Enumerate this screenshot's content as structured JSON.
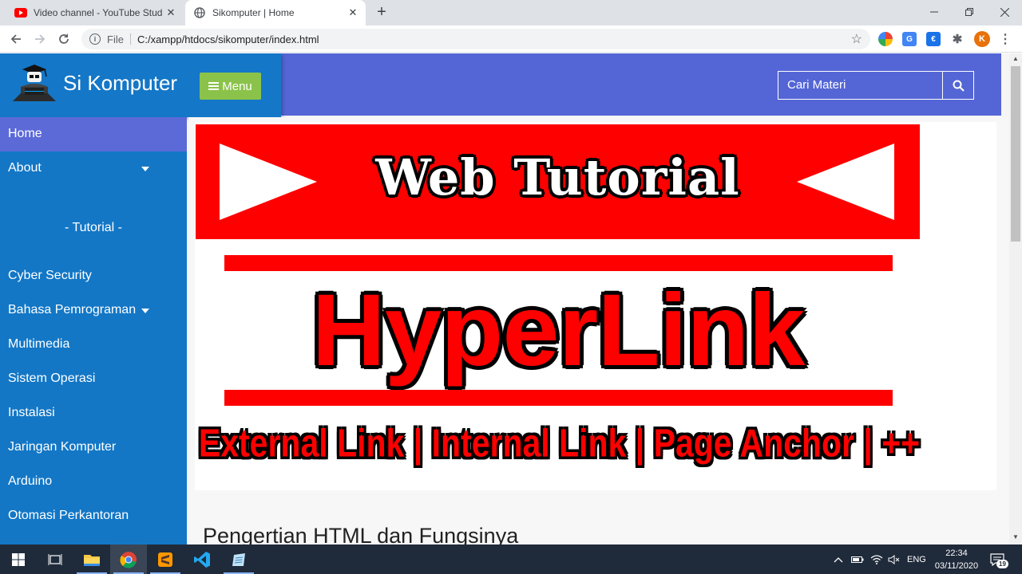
{
  "browser": {
    "tabs": [
      {
        "title": "Video channel - YouTube Studio",
        "icon": "youtube-icon",
        "active": false
      },
      {
        "title": "Sikomputer | Home",
        "icon": "globe-icon",
        "active": true
      }
    ],
    "close_glyph": "✕",
    "new_tab_glyph": "+",
    "address": {
      "scheme_label": "File",
      "url": "C:/xampp/htdocs/sikomputer/index.html"
    },
    "profile_initial": "K",
    "accent": "#5466d6"
  },
  "site": {
    "brand": "Si Komputer",
    "menu_label": "Menu",
    "search_placeholder": "Cari Materi",
    "header_color": "#5466d6",
    "sidebar_color": "#1377c6",
    "menu_button_color": "#8bc34a"
  },
  "sidebar": {
    "top_items": [
      {
        "label": "Home",
        "active": true
      },
      {
        "label": "About",
        "dropdown": true
      }
    ],
    "section_heading": "- Tutorial -",
    "items": [
      {
        "label": "Cyber Security"
      },
      {
        "label": "Bahasa Pemrograman",
        "dropdown": true
      },
      {
        "label": "Multimedia"
      },
      {
        "label": "Sistem Operasi"
      },
      {
        "label": "Instalasi"
      },
      {
        "label": "Jaringan Komputer"
      },
      {
        "label": "Arduino"
      },
      {
        "label": "Otomasi Perkantoran"
      }
    ]
  },
  "banner": {
    "top_text": "Web Tutorial",
    "main_text": "HyperLink",
    "sub_text": "External Link | Internal Link | Page Anchor | ++",
    "primary_color": "#ff0000"
  },
  "article": {
    "title": "Pengertian HTML dan Fungsinya"
  },
  "taskbar": {
    "apps": [
      "windows-start-icon",
      "task-view-icon",
      "file-explorer-icon",
      "chrome-icon",
      "sublime-text-icon",
      "vscode-icon",
      "notepad-icon"
    ],
    "language": "ENG",
    "time": "22:34",
    "date": "03/11/2020",
    "notification_count": "19"
  }
}
